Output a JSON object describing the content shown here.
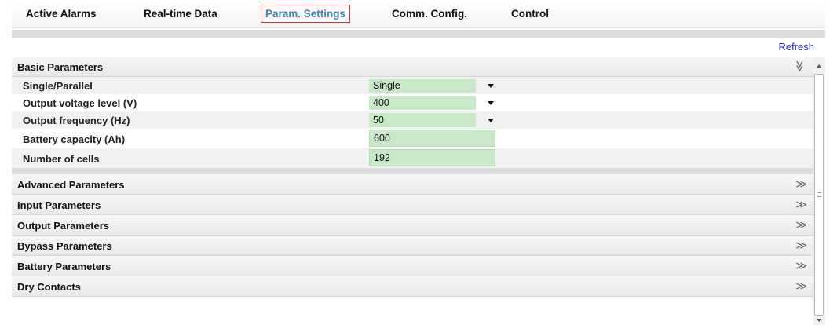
{
  "tabs": [
    {
      "label": "Active Alarms"
    },
    {
      "label": "Real-time Data"
    },
    {
      "label": "Param. Settings"
    },
    {
      "label": "Comm. Config."
    },
    {
      "label": "Control"
    }
  ],
  "active_tab": "Param. Settings",
  "refresh_label": "Refresh",
  "basic": {
    "title": "Basic Parameters",
    "chevron": "≫",
    "single_parallel": {
      "label": "Single/Parallel",
      "value": "Single"
    },
    "output_voltage": {
      "label": "Output voltage level (V)",
      "value": "400"
    },
    "output_frequency": {
      "label": "Output frequency (Hz)",
      "value": "50"
    },
    "battery_capacity": {
      "label": "Battery capacity (Ah)",
      "value": "600"
    },
    "number_of_cells": {
      "label": "Number of cells",
      "value": "192"
    }
  },
  "sections": [
    {
      "title": "Advanced Parameters",
      "chevron": "≫"
    },
    {
      "title": "Input Parameters",
      "chevron": "≫"
    },
    {
      "title": "Output Parameters",
      "chevron": "≫"
    },
    {
      "title": "Bypass Parameters",
      "chevron": "≫"
    },
    {
      "title": "Battery Parameters",
      "chevron": "≫"
    },
    {
      "title": "Dry Contacts",
      "chevron": "≫"
    }
  ],
  "colors": {
    "accent": "#4a7fa8",
    "highlight_border": "#e0303a",
    "field_bg": "#c8e8c8",
    "link": "#2a2ad0"
  }
}
